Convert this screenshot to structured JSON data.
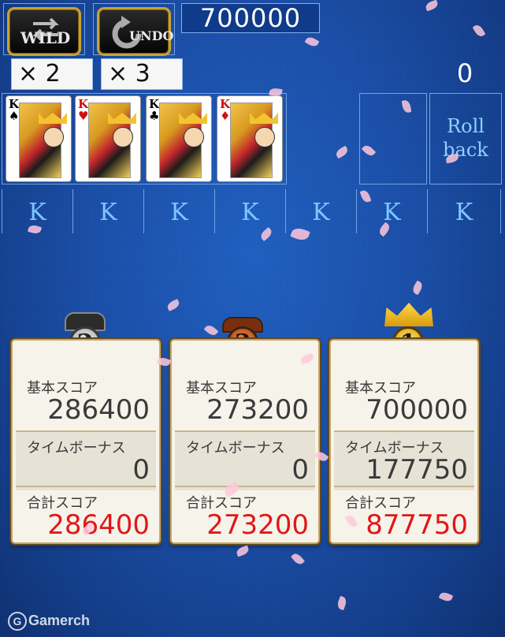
{
  "toolbar": {
    "wild": {
      "label": "WILD",
      "count": "× 2"
    },
    "undo": {
      "label": "UNDO",
      "count": "× 3"
    }
  },
  "score_display": "700000",
  "move_counter": "0",
  "cards": [
    {
      "rank": "K",
      "suit": "♠",
      "color": "#111111"
    },
    {
      "rank": "K",
      "suit": "♥",
      "color": "#d01010"
    },
    {
      "rank": "K",
      "suit": "♣",
      "color": "#111111"
    },
    {
      "rank": "K",
      "suit": "♦",
      "color": "#d01010"
    }
  ],
  "rollback_label": "Roll back",
  "rank_row": [
    "K",
    "K",
    "K",
    "K",
    "K",
    "K",
    "K"
  ],
  "results": [
    {
      "rank": "2",
      "medal": "silver",
      "base_label": "基本スコア",
      "base": "286400",
      "bonus_label": "タイムボーナス",
      "bonus": "0",
      "total_label": "合計スコア",
      "total": "286400"
    },
    {
      "rank": "3",
      "medal": "bronze",
      "base_label": "基本スコア",
      "base": "273200",
      "bonus_label": "タイムボーナス",
      "bonus": "0",
      "total_label": "合計スコア",
      "total": "273200"
    },
    {
      "rank": "1",
      "medal": "gold",
      "base_label": "基本スコア",
      "base": "700000",
      "bonus_label": "タイムボーナス",
      "bonus": "177750",
      "total_label": "合計スコア",
      "total": "877750"
    }
  ],
  "watermark": "Gamerch",
  "colors": {
    "accent_blue": "#7ec6ff",
    "total_red": "#e01818",
    "gold_border": "#c9a232"
  }
}
